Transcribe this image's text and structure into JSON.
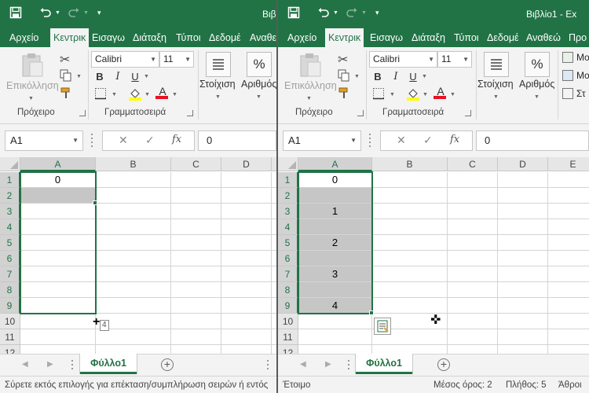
{
  "colors": {
    "accent": "#217346",
    "ribbon_bg": "#f3f3f3",
    "selection_fill": "#c6c6c6"
  },
  "left": {
    "title": "Βιβ",
    "tabs": [
      "Αρχείο",
      "Κεντρικ",
      "Εισαγω",
      "Διάταξη",
      "Τύποι",
      "Δεδομέ",
      "Αναθε"
    ],
    "ribbon": {
      "paste_label": "Επικόλληση",
      "font_name": "Calibri",
      "font_size": "11",
      "bold": "B",
      "italic": "I",
      "underline": "U",
      "alignment_label": "Στοίχιση",
      "number_label": "Αριθμός",
      "percent": "%",
      "group_clipboard": "Πρόχειρο",
      "group_font": "Γραμματοσειρά"
    },
    "formula_bar": {
      "name_box": "A1",
      "fx": "fx",
      "value": "0"
    },
    "grid": {
      "columns": [
        "A",
        "B",
        "C",
        "D"
      ],
      "rows": [
        "1",
        "2",
        "3",
        "4",
        "5",
        "6",
        "7",
        "8",
        "9",
        "10",
        "11",
        "12"
      ],
      "a1": "0",
      "drag_tooltip": "4"
    },
    "sheet_tab": "Φύλλο1",
    "status_text": "Σύρετε εκτός επιλογής για επέκταση/συμπλήρωση σειρών ή εντός"
  },
  "right": {
    "title": "Βιβλίο1 - Ex",
    "tabs": [
      "Αρχείο",
      "Κεντρικ",
      "Εισαγω",
      "Διάταξη",
      "Τύποι",
      "Δεδομέ",
      "Αναθεώ",
      "Προ"
    ],
    "ribbon": {
      "paste_label": "Επικόλληση",
      "font_name": "Calibri",
      "font_size": "11",
      "bold": "B",
      "italic": "I",
      "underline": "U",
      "alignment_label": "Στοίχιση",
      "number_label": "Αριθμός",
      "percent": "%",
      "group_clipboard": "Πρόχειρο",
      "group_font": "Γραμματοσειρά",
      "styles_items": [
        "Μο",
        "Μο",
        "Στ"
      ]
    },
    "formula_bar": {
      "name_box": "A1",
      "fx": "fx",
      "value": "0"
    },
    "grid": {
      "columns": [
        "A",
        "B",
        "C",
        "D",
        "E"
      ],
      "rows": [
        "1",
        "2",
        "3",
        "4",
        "5",
        "6",
        "7",
        "8",
        "9",
        "10",
        "11",
        "12"
      ],
      "col_a_values": [
        "0",
        "",
        "1",
        "",
        "2",
        "",
        "3",
        "",
        "4"
      ]
    },
    "sheet_tab": "Φύλλο1",
    "status": {
      "ready": "Έτοιμο",
      "average": "Μέσος όρος: 2",
      "count": "Πλήθος: 5",
      "sum": "Άθροι"
    }
  }
}
